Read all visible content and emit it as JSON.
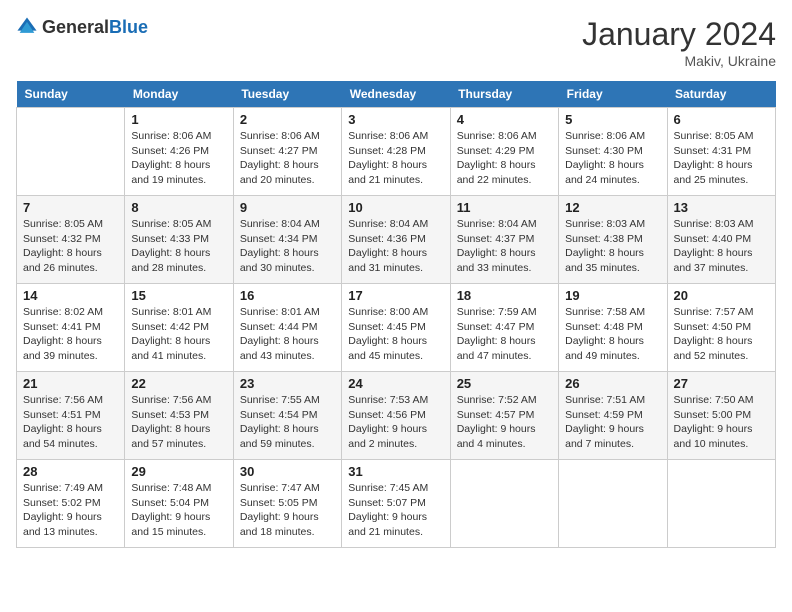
{
  "header": {
    "logo_general": "General",
    "logo_blue": "Blue",
    "month": "January 2024",
    "location": "Makiv, Ukraine"
  },
  "columns": [
    "Sunday",
    "Monday",
    "Tuesday",
    "Wednesday",
    "Thursday",
    "Friday",
    "Saturday"
  ],
  "weeks": [
    [
      {
        "day": "",
        "info": ""
      },
      {
        "day": "1",
        "info": "Sunrise: 8:06 AM\nSunset: 4:26 PM\nDaylight: 8 hours\nand 19 minutes."
      },
      {
        "day": "2",
        "info": "Sunrise: 8:06 AM\nSunset: 4:27 PM\nDaylight: 8 hours\nand 20 minutes."
      },
      {
        "day": "3",
        "info": "Sunrise: 8:06 AM\nSunset: 4:28 PM\nDaylight: 8 hours\nand 21 minutes."
      },
      {
        "day": "4",
        "info": "Sunrise: 8:06 AM\nSunset: 4:29 PM\nDaylight: 8 hours\nand 22 minutes."
      },
      {
        "day": "5",
        "info": "Sunrise: 8:06 AM\nSunset: 4:30 PM\nDaylight: 8 hours\nand 24 minutes."
      },
      {
        "day": "6",
        "info": "Sunrise: 8:05 AM\nSunset: 4:31 PM\nDaylight: 8 hours\nand 25 minutes."
      }
    ],
    [
      {
        "day": "7",
        "info": "Sunrise: 8:05 AM\nSunset: 4:32 PM\nDaylight: 8 hours\nand 26 minutes."
      },
      {
        "day": "8",
        "info": "Sunrise: 8:05 AM\nSunset: 4:33 PM\nDaylight: 8 hours\nand 28 minutes."
      },
      {
        "day": "9",
        "info": "Sunrise: 8:04 AM\nSunset: 4:34 PM\nDaylight: 8 hours\nand 30 minutes."
      },
      {
        "day": "10",
        "info": "Sunrise: 8:04 AM\nSunset: 4:36 PM\nDaylight: 8 hours\nand 31 minutes."
      },
      {
        "day": "11",
        "info": "Sunrise: 8:04 AM\nSunset: 4:37 PM\nDaylight: 8 hours\nand 33 minutes."
      },
      {
        "day": "12",
        "info": "Sunrise: 8:03 AM\nSunset: 4:38 PM\nDaylight: 8 hours\nand 35 minutes."
      },
      {
        "day": "13",
        "info": "Sunrise: 8:03 AM\nSunset: 4:40 PM\nDaylight: 8 hours\nand 37 minutes."
      }
    ],
    [
      {
        "day": "14",
        "info": "Sunrise: 8:02 AM\nSunset: 4:41 PM\nDaylight: 8 hours\nand 39 minutes."
      },
      {
        "day": "15",
        "info": "Sunrise: 8:01 AM\nSunset: 4:42 PM\nDaylight: 8 hours\nand 41 minutes."
      },
      {
        "day": "16",
        "info": "Sunrise: 8:01 AM\nSunset: 4:44 PM\nDaylight: 8 hours\nand 43 minutes."
      },
      {
        "day": "17",
        "info": "Sunrise: 8:00 AM\nSunset: 4:45 PM\nDaylight: 8 hours\nand 45 minutes."
      },
      {
        "day": "18",
        "info": "Sunrise: 7:59 AM\nSunset: 4:47 PM\nDaylight: 8 hours\nand 47 minutes."
      },
      {
        "day": "19",
        "info": "Sunrise: 7:58 AM\nSunset: 4:48 PM\nDaylight: 8 hours\nand 49 minutes."
      },
      {
        "day": "20",
        "info": "Sunrise: 7:57 AM\nSunset: 4:50 PM\nDaylight: 8 hours\nand 52 minutes."
      }
    ],
    [
      {
        "day": "21",
        "info": "Sunrise: 7:56 AM\nSunset: 4:51 PM\nDaylight: 8 hours\nand 54 minutes."
      },
      {
        "day": "22",
        "info": "Sunrise: 7:56 AM\nSunset: 4:53 PM\nDaylight: 8 hours\nand 57 minutes."
      },
      {
        "day": "23",
        "info": "Sunrise: 7:55 AM\nSunset: 4:54 PM\nDaylight: 8 hours\nand 59 minutes."
      },
      {
        "day": "24",
        "info": "Sunrise: 7:53 AM\nSunset: 4:56 PM\nDaylight: 9 hours\nand 2 minutes."
      },
      {
        "day": "25",
        "info": "Sunrise: 7:52 AM\nSunset: 4:57 PM\nDaylight: 9 hours\nand 4 minutes."
      },
      {
        "day": "26",
        "info": "Sunrise: 7:51 AM\nSunset: 4:59 PM\nDaylight: 9 hours\nand 7 minutes."
      },
      {
        "day": "27",
        "info": "Sunrise: 7:50 AM\nSunset: 5:00 PM\nDaylight: 9 hours\nand 10 minutes."
      }
    ],
    [
      {
        "day": "28",
        "info": "Sunrise: 7:49 AM\nSunset: 5:02 PM\nDaylight: 9 hours\nand 13 minutes."
      },
      {
        "day": "29",
        "info": "Sunrise: 7:48 AM\nSunset: 5:04 PM\nDaylight: 9 hours\nand 15 minutes."
      },
      {
        "day": "30",
        "info": "Sunrise: 7:47 AM\nSunset: 5:05 PM\nDaylight: 9 hours\nand 18 minutes."
      },
      {
        "day": "31",
        "info": "Sunrise: 7:45 AM\nSunset: 5:07 PM\nDaylight: 9 hours\nand 21 minutes."
      },
      {
        "day": "",
        "info": ""
      },
      {
        "day": "",
        "info": ""
      },
      {
        "day": "",
        "info": ""
      }
    ]
  ]
}
